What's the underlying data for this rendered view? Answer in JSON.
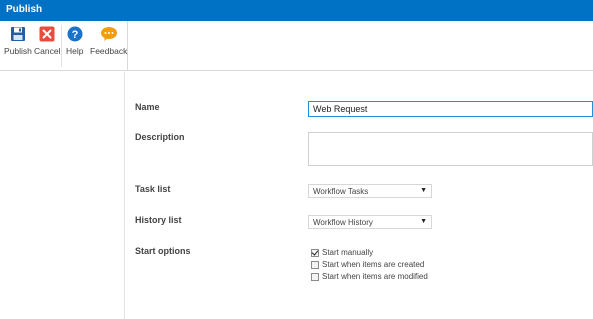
{
  "window": {
    "title": "Publish"
  },
  "ribbon": {
    "buttons": [
      {
        "label": "Publish",
        "icon": "save-icon"
      },
      {
        "label": "Cancel",
        "icon": "close-icon"
      },
      {
        "label": "Help",
        "icon": "help-icon"
      },
      {
        "label": "Feedback",
        "icon": "feedback-icon"
      }
    ]
  },
  "form": {
    "name": {
      "label": "Name",
      "value": "Web Request"
    },
    "description": {
      "label": "Description",
      "value": ""
    },
    "task_list": {
      "label": "Task list",
      "selected": "Workflow Tasks"
    },
    "history_list": {
      "label": "History list",
      "selected": "Workflow History"
    },
    "start_options": {
      "label": "Start options",
      "options": [
        {
          "label": "Start manually",
          "checked": true
        },
        {
          "label": "Start when items are created",
          "checked": false
        },
        {
          "label": "Start when items are modified",
          "checked": false
        }
      ]
    }
  },
  "colors": {
    "titlebar": "#0072c6",
    "cancel": "#e74c3c",
    "help": "#1a73c8",
    "feedback": "#f39c12"
  }
}
